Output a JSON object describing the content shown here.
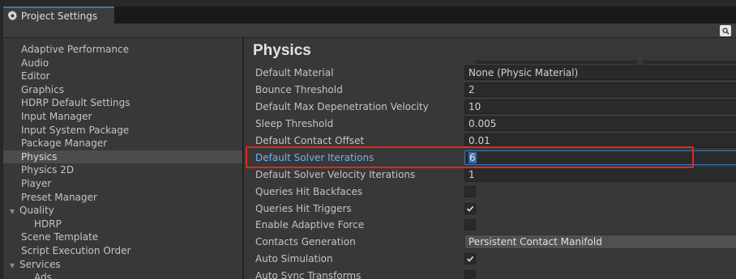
{
  "window": {
    "tab_title": "Project Settings"
  },
  "sidebar": {
    "items": [
      {
        "label": "Adaptive Performance",
        "kind": "top"
      },
      {
        "label": "Audio",
        "kind": "top"
      },
      {
        "label": "Editor",
        "kind": "top"
      },
      {
        "label": "Graphics",
        "kind": "top"
      },
      {
        "label": "HDRP Default Settings",
        "kind": "top"
      },
      {
        "label": "Input Manager",
        "kind": "top"
      },
      {
        "label": "Input System Package",
        "kind": "top"
      },
      {
        "label": "Package Manager",
        "kind": "top"
      },
      {
        "label": "Physics",
        "kind": "top",
        "selected": true
      },
      {
        "label": "Physics 2D",
        "kind": "top"
      },
      {
        "label": "Player",
        "kind": "top"
      },
      {
        "label": "Preset Manager",
        "kind": "top"
      },
      {
        "label": "Quality",
        "kind": "parent"
      },
      {
        "label": "HDRP",
        "kind": "child"
      },
      {
        "label": "Scene Template",
        "kind": "top"
      },
      {
        "label": "Script Execution Order",
        "kind": "top"
      },
      {
        "label": "Services",
        "kind": "parent"
      },
      {
        "label": "Ads",
        "kind": "child"
      }
    ]
  },
  "main": {
    "title": "Physics",
    "rows": [
      {
        "label": "Default Material",
        "type": "object",
        "value": "None (Physic Material)"
      },
      {
        "label": "Bounce Threshold",
        "type": "number",
        "value": "2"
      },
      {
        "label": "Default Max Depenetration Velocity",
        "type": "number",
        "value": "10"
      },
      {
        "label": "Sleep Threshold",
        "type": "number",
        "value": "0.005"
      },
      {
        "label": "Default Contact Offset",
        "type": "number",
        "value": "0.01"
      },
      {
        "label": "Default Solver Iterations",
        "type": "number",
        "value": "6",
        "focused": true
      },
      {
        "label": "Default Solver Velocity Iterations",
        "type": "number",
        "value": "1"
      },
      {
        "label": "Queries Hit Backfaces",
        "type": "checkbox",
        "checked": false
      },
      {
        "label": "Queries Hit Triggers",
        "type": "checkbox",
        "checked": true
      },
      {
        "label": "Enable Adaptive Force",
        "type": "checkbox",
        "checked": false
      },
      {
        "label": "Contacts Generation",
        "type": "dropdown",
        "value": "Persistent Contact Manifold"
      },
      {
        "label": "Auto Simulation",
        "type": "checkbox",
        "checked": true
      },
      {
        "label": "Auto Sync Transforms",
        "type": "checkbox",
        "checked": false
      }
    ]
  },
  "colors": {
    "accent": "#3a79bb",
    "highlight_box": "#e02a1a",
    "focused_label": "#78aef0"
  }
}
